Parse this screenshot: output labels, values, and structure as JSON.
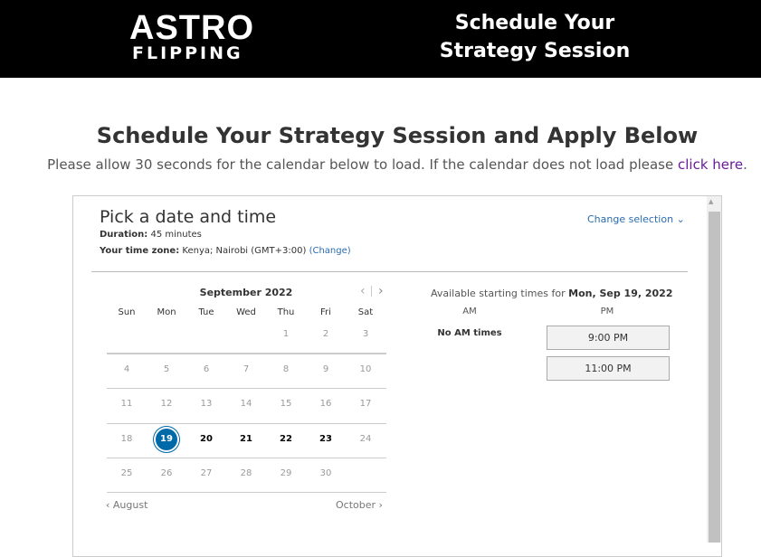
{
  "header": {
    "logo_line1": "ASTRO",
    "logo_line2": "FLIPPING",
    "title": "Schedule Your Strategy Session"
  },
  "main": {
    "title": "Schedule Your Strategy Session and Apply Below",
    "subtitle_pre": "Please allow 30 seconds for the calendar below to load. If the calendar does not load please ",
    "link_text": "click here",
    "subtitle_post": "."
  },
  "scheduler": {
    "heading": "Pick a date and time",
    "duration_label": "Duration:",
    "duration_value": "45 minutes",
    "timezone_label": "Your time zone:",
    "timezone_value": "Kenya;  Nairobi  (GMT+3:00)",
    "timezone_change": "(Change)",
    "change_selection": "Change selection",
    "calendar": {
      "month": "September 2022",
      "weekdays": [
        "Sun",
        "Mon",
        "Tue",
        "Wed",
        "Thu",
        "Fri",
        "Sat"
      ],
      "weeks": [
        [
          "",
          "",
          "",
          "",
          "1",
          "2",
          "3"
        ],
        [
          "4",
          "5",
          "6",
          "7",
          "8",
          "9",
          "10"
        ],
        [
          "11",
          "12",
          "13",
          "14",
          "15",
          "16",
          "17"
        ],
        [
          "18",
          "19",
          "20",
          "21",
          "22",
          "23",
          "24"
        ],
        [
          "25",
          "26",
          "27",
          "28",
          "29",
          "30",
          ""
        ]
      ],
      "selected": "19",
      "available": [
        "19",
        "20",
        "21",
        "22",
        "23"
      ],
      "prev_month": "August",
      "next_month": "October"
    },
    "times": {
      "label": "Available starting times for ",
      "date": "Mon, Sep 19, 2022",
      "am_label": "AM",
      "pm_label": "PM",
      "no_am": "No AM times",
      "pm_slots": [
        "9:00 PM",
        "11:00 PM"
      ]
    }
  },
  "colors": {
    "header_bg": "#000000",
    "accent": "#0069a8",
    "link": "#6a1b9a"
  }
}
